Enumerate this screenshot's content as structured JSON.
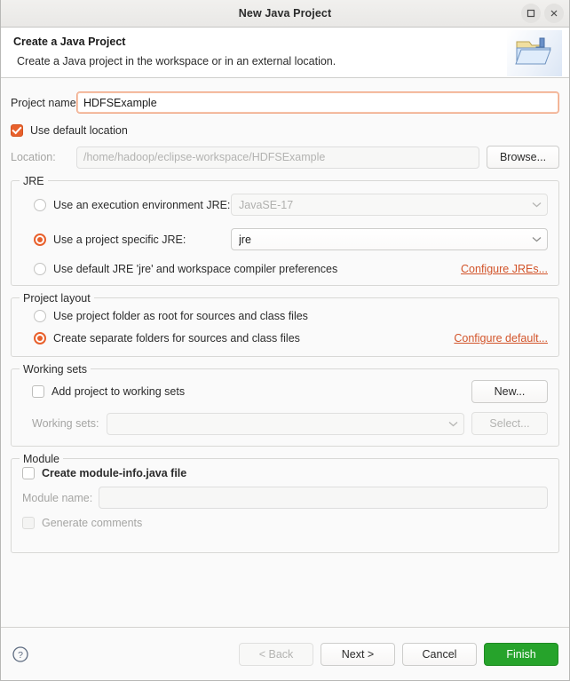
{
  "window": {
    "title": "New Java Project",
    "maximize_icon": "maximize-icon",
    "close_icon": "close-icon"
  },
  "header": {
    "title": "Create a Java Project",
    "description": "Create a Java project in the workspace or in an external location.",
    "icon": "java-project-folder-icon"
  },
  "project": {
    "name_label": "Project name:",
    "name_value": "HDFSExample",
    "name_placeholder": "",
    "use_default_location_label": "Use default location",
    "use_default_location_checked": true,
    "location_label": "Location:",
    "location_value": "/home/hadoop/eclipse-workspace/HDFSExample",
    "browse_label": "Browse..."
  },
  "jre": {
    "group_title": "JRE",
    "execution_env_label": "Use an execution environment JRE:",
    "execution_env_selected": false,
    "execution_env_value": "JavaSE-17",
    "project_specific_label": "Use a project specific JRE:",
    "project_specific_selected": true,
    "project_specific_value": "jre",
    "default_jre_label": "Use default JRE 'jre' and workspace compiler preferences",
    "default_jre_selected": false,
    "configure_link": "Configure JREs..."
  },
  "layout": {
    "group_title": "Project layout",
    "root_folder_label": "Use project folder as root for sources and class files",
    "root_folder_selected": false,
    "separate_folders_label": "Create separate folders for sources and class files",
    "separate_folders_selected": true,
    "configure_link": "Configure default..."
  },
  "working_sets": {
    "group_title": "Working sets",
    "add_label": "Add project to working sets",
    "add_checked": false,
    "new_label": "New...",
    "sets_label": "Working sets:",
    "sets_value": "",
    "select_label": "Select..."
  },
  "module": {
    "group_title": "Module",
    "create_module_info_label": "Create module-info.java file",
    "create_module_info_checked": false,
    "module_name_label": "Module name:",
    "module_name_value": "",
    "generate_comments_label": "Generate comments",
    "generate_comments_checked": false
  },
  "footer": {
    "help_icon": "help-icon",
    "back_label": "< Back",
    "next_label": "Next >",
    "cancel_label": "Cancel",
    "finish_label": "Finish"
  },
  "colors": {
    "accent": "#e8602c",
    "link": "#d2542a",
    "finish": "#26a32b",
    "window_bg": "#fafafa"
  }
}
